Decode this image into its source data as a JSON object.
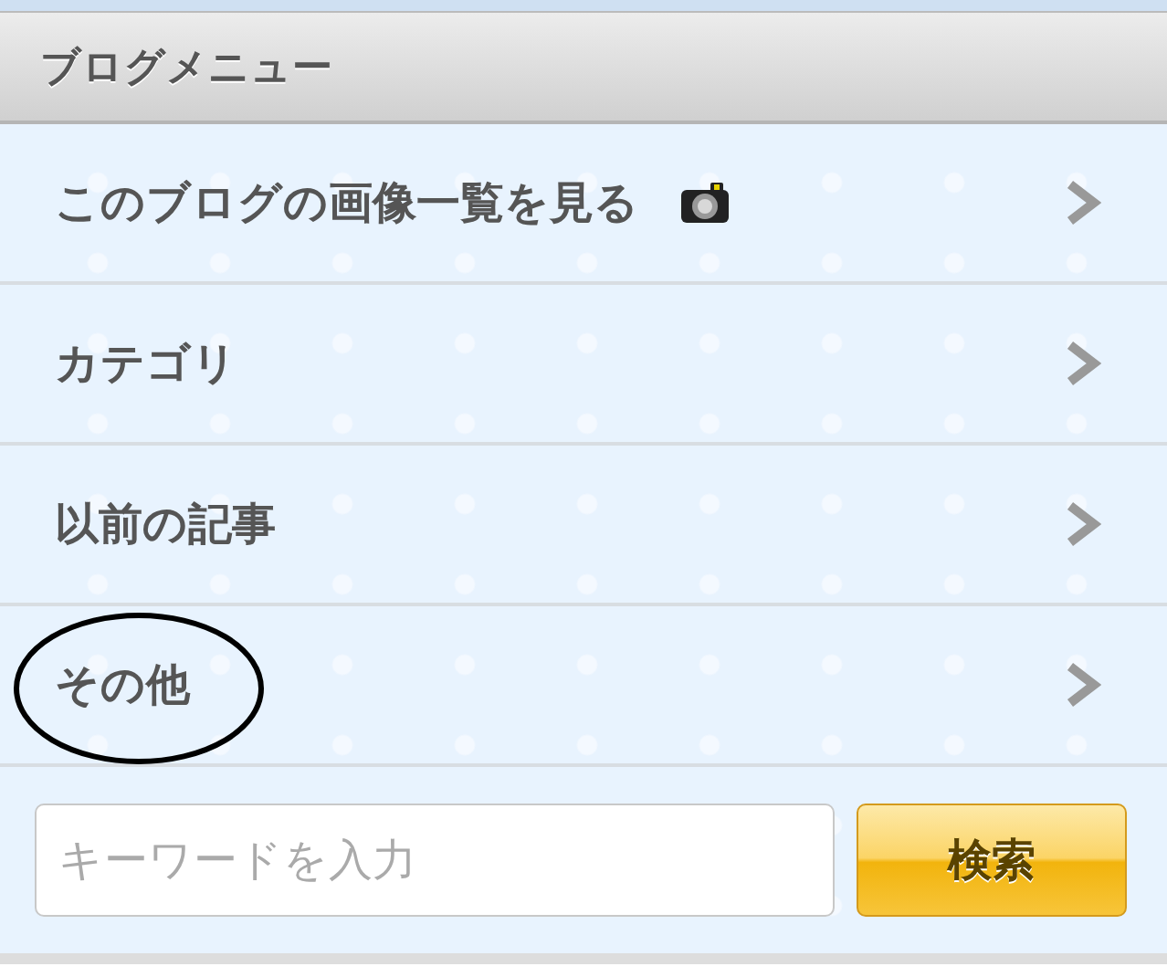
{
  "menu": {
    "title": "ブログメニュー",
    "items": [
      {
        "label": "このブログの画像一覧を見る",
        "kind": "photos",
        "circled": false
      },
      {
        "label": "カテゴリ",
        "kind": "plain",
        "circled": false
      },
      {
        "label": "以前の記事",
        "kind": "plain",
        "circled": false
      },
      {
        "label": "その他",
        "kind": "plain",
        "circled": true
      }
    ]
  },
  "search": {
    "placeholder": "キーワードを入力",
    "button": "検索"
  }
}
